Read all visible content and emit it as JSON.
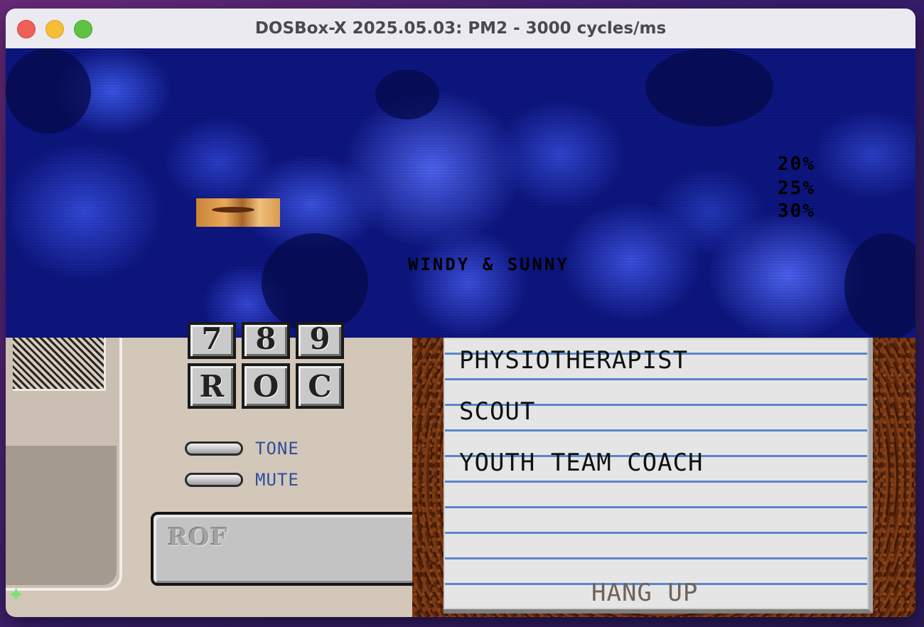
{
  "window": {
    "title": "DOSBox-X 2025.05.03: PM2 - 3000 cycles/ms"
  },
  "game": {
    "odds": [
      "20%",
      "25%",
      "30%"
    ],
    "player_name": "WINDY & SUNNY"
  },
  "phone": {
    "keys_top": [
      "7",
      "8",
      "9"
    ],
    "keys_bottom": [
      "R",
      "O",
      "C"
    ],
    "tone_label": "TONE",
    "mute_label": "MUTE",
    "display_text": "ROF"
  },
  "contacts": {
    "items": [
      "PHYSIOTHERAPIST",
      "SCOUT",
      "YOUTH TEAM COACH"
    ],
    "hang_up_label": "HANG UP"
  },
  "colors": {
    "crowd_blue": "#0d1680",
    "notepad_line": "#5b86c8",
    "label_blue": "#2e4f9a"
  }
}
